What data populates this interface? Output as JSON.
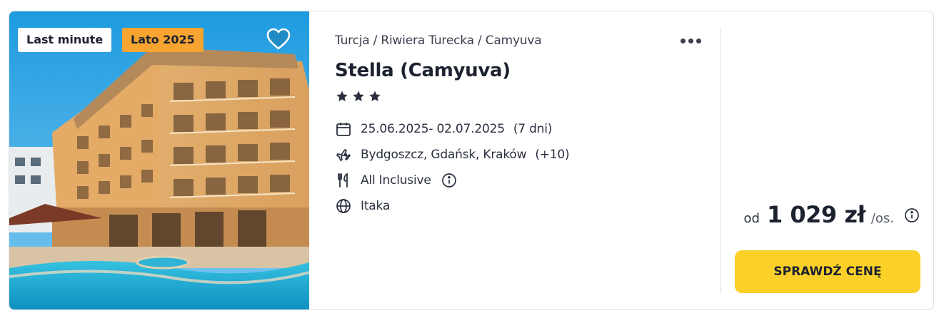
{
  "badges": {
    "last_minute": "Last minute",
    "season": "Lato 2025"
  },
  "breadcrumb": "Turcja / Riwiera Turecka / Camyuva",
  "hotel": {
    "name": "Stella (Camyuva)",
    "stars": 3
  },
  "details": {
    "dates": "25.06.2025- 02.07.2025",
    "duration": "(7 dni)",
    "airports": "Bydgoszcz, Gdańsk, Kraków",
    "airports_more": "(+10)",
    "board": "All Inclusive",
    "operator": "Itaka"
  },
  "price": {
    "prefix": "od",
    "amount": "1 029 zł",
    "suffix": "/os."
  },
  "cta_label": "SPRAWDŹ CENĘ",
  "icons": {
    "favorite": "heart-icon",
    "more": "more-options-icon",
    "star": "star-icon",
    "dates": "calendar-icon",
    "airports": "plane-icon",
    "board": "cutlery-icon",
    "board_info": "info-icon",
    "operator": "globe-icon",
    "price_info": "info-icon"
  },
  "colors": {
    "badge_season": "#f7a530",
    "cta": "#fbd028",
    "text_dark": "#1d2230",
    "border": "#dcdfe4"
  }
}
